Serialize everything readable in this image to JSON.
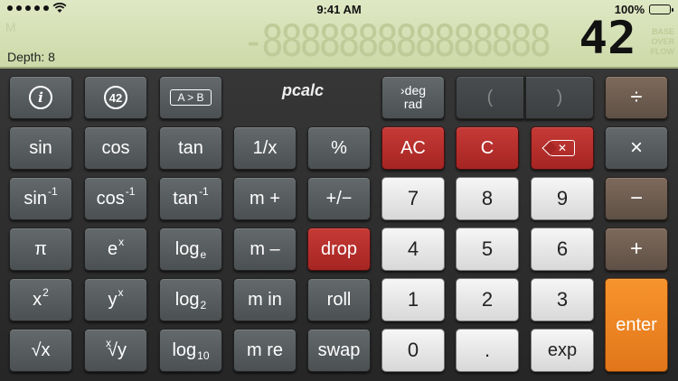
{
  "status": {
    "time": "9:41 AM",
    "battery": "100%",
    "battery_level": 1.0
  },
  "display": {
    "value": "42",
    "depth": "Depth: 8",
    "ghost_digits": "-888888888888888",
    "ghost_m": "M",
    "ovfl_top": "BASE",
    "ovfl_mid": "OVER",
    "ovfl_bot": "FLOW"
  },
  "logo": "pcalc",
  "keys": {
    "info": "i",
    "badge": "42",
    "swap_ab": "A > B",
    "deg": "deg",
    "rad": "rad",
    "lparen": "(",
    "rparen": ")",
    "divide": "÷",
    "sin": "sin",
    "cos": "cos",
    "tan": "tan",
    "reciprocal": "1/x",
    "percent": "%",
    "ac": "AC",
    "c": "C",
    "multiply": "×",
    "asin": "sin",
    "acos": "cos",
    "atan": "tan",
    "inv_sup": "-1",
    "mplus": "m +",
    "plusminus": "+/−",
    "seven": "7",
    "eight": "8",
    "nine": "9",
    "minus": "−",
    "pi": "π",
    "ex_base": "e",
    "ex_sup": "x",
    "loge_base": "log",
    "loge_sub": "e",
    "mminus": "m –",
    "drop": "drop",
    "four": "4",
    "five": "5",
    "six": "6",
    "plus": "+",
    "x2_base": "x",
    "x2_sup": "2",
    "yx_base": "y",
    "yx_sup": "x",
    "log2_base": "log",
    "log2_sub": "2",
    "min": "m in",
    "roll": "roll",
    "one": "1",
    "two": "2",
    "three": "3",
    "enter": "enter",
    "sqrt": "√x",
    "xroot_sup": "x",
    "xroot_base": "√y",
    "log10_base": "log",
    "log10_sub": "10",
    "mre": "m re",
    "swap": "swap",
    "zero": "0",
    "dot": ".",
    "exp": "exp"
  },
  "colors": {
    "lcd": "#d8e2b8",
    "red_key": "#b52e2b",
    "enter": "#ee8a24",
    "op_key": "#6e5d51"
  }
}
